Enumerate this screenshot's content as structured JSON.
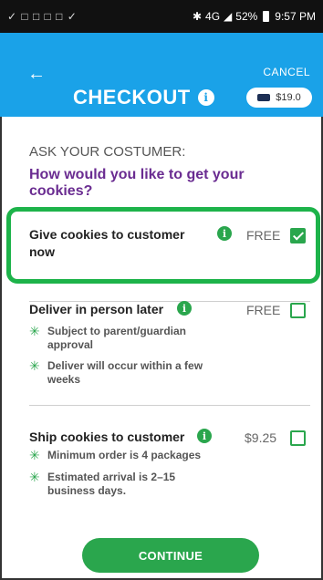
{
  "statusbar": {
    "left_icons": "✓ □ □ □ □ ✓",
    "signal_text": "4G",
    "battery": "52%",
    "time": "9:57 PM"
  },
  "header": {
    "title": "CHECKOUT",
    "cancel_label": "CANCEL",
    "back_icon": "←",
    "cart_total": "$19.0"
  },
  "prompt": {
    "label": "ASK YOUR COSTUMER:",
    "question": "How would you like to get your cookies?"
  },
  "options": [
    {
      "title": "Give cookies to customer now",
      "price": "FREE",
      "checked": true,
      "bullets": []
    },
    {
      "title": "Deliver in person later",
      "price": "FREE",
      "checked": false,
      "bullets": [
        "Subject to parent/guardian approval",
        "Deliver will occur within a few weeks"
      ]
    },
    {
      "title": "Ship cookies to customer",
      "price": "$9.25",
      "checked": false,
      "bullets": [
        "Minimum order is 4 packages",
        "Estimated arrival is 2–15 business days."
      ]
    }
  ],
  "continue_label": "CONTINUE",
  "colors": {
    "appbar": "#1aa2e8",
    "accent_green": "#2aa64d",
    "question_purple": "#6a2c91",
    "highlight": "#1db34a"
  }
}
